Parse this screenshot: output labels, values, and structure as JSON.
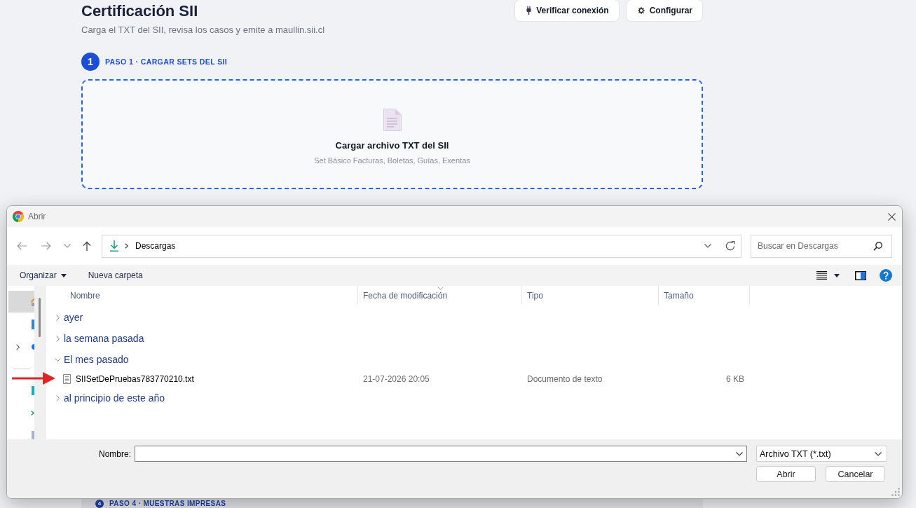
{
  "header": {
    "title": "Certificación SII",
    "subtitle": "Carga el TXT del SII, revisa los casos y emite a maullin.sii.cl",
    "buttons": [
      {
        "kind": "plug",
        "label": "Verificar conexión"
      },
      {
        "kind": "gear",
        "label": "Configurar"
      }
    ]
  },
  "steps": [
    {
      "number": "1",
      "label": "PASO 1 · CARGAR SETS DEL SII"
    },
    {
      "number": "4",
      "label": "PASO 4 · MUESTRAS IMPRESAS"
    }
  ],
  "dropzone": {
    "title": "Cargar archivo TXT del SII",
    "hint": "Set Básico Facturas, Boletas, Guías, Exentas"
  },
  "dialog": {
    "title": "Abrir",
    "path": [
      "Descargas"
    ],
    "search": {
      "placeholder": "Buscar en Descargas"
    },
    "commands": [
      {
        "kind": "menu",
        "label": "Organizar"
      },
      {
        "kind": "action",
        "label": "Nueva carpeta"
      }
    ],
    "sidebar": [
      {
        "kind": "home",
        "selected": true
      },
      {
        "kind": "desktop",
        "selected": false
      },
      {
        "kind": "cloud",
        "selected": false,
        "expanded": false
      },
      {
        "kind": "divider"
      },
      {
        "kind": "app",
        "selected": false
      },
      {
        "kind": "mark",
        "selected": false
      },
      {
        "kind": "page",
        "selected": false
      }
    ],
    "columns": [
      {
        "label": "Nombre",
        "sorted": false
      },
      {
        "label": "Fecha de modificación",
        "sorted": true
      },
      {
        "label": "Tipo",
        "sorted": false
      },
      {
        "label": "Tamaño",
        "sorted": false
      }
    ],
    "groups": [
      {
        "label": "ayer",
        "expanded": false
      },
      {
        "label": "la semana pasada",
        "expanded": false
      },
      {
        "label": "El mes pasado",
        "expanded": true,
        "children": [
          {
            "name": "SIISetDePruebas783770210.txt",
            "modified": "21-07-2026 20:05",
            "type": "Documento de texto",
            "size": "6 KB"
          }
        ]
      },
      {
        "label": "al principio de este año",
        "expanded": false
      }
    ],
    "file_name": {
      "label": "Nombre:"
    },
    "file_type": "Archivo TXT (*.txt)",
    "buttons": [
      "Abrir",
      "Cancelar"
    ]
  }
}
